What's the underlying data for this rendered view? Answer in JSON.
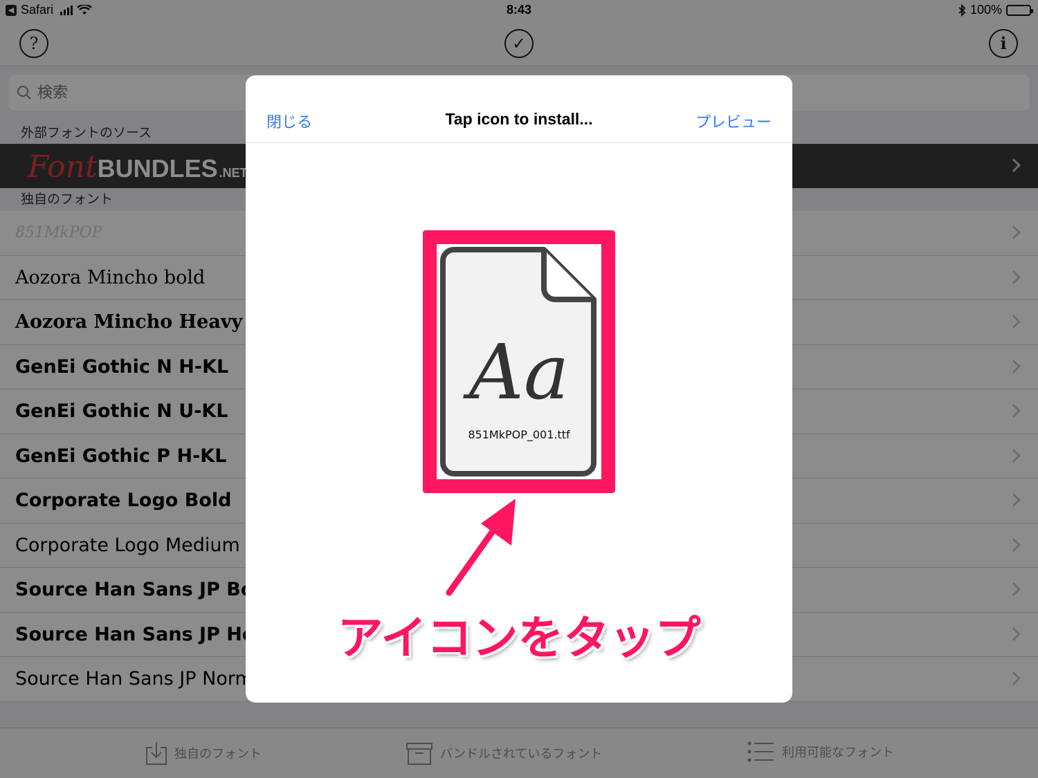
{
  "status_bar": {
    "back_app": "Safari",
    "time": "8:43",
    "battery": "100%"
  },
  "nav_bar": {
    "help_icon": "?",
    "check_icon": "✓",
    "info_icon": "i"
  },
  "search": {
    "placeholder": "検索"
  },
  "sections": {
    "external": "外部フォントのソース",
    "own": "独自のフォント"
  },
  "fontbundles": {
    "part1": "Font",
    "part2": "BUNDLES",
    "part3": ".NET"
  },
  "fonts": [
    {
      "label": "851MkPOP"
    },
    {
      "label": "Aozora Mincho bold"
    },
    {
      "label": "Aozora Mincho Heavy"
    },
    {
      "label": "GenEi Gothic N H-KL"
    },
    {
      "label": "GenEi Gothic N U-KL"
    },
    {
      "label": "GenEi Gothic P H-KL"
    },
    {
      "label": "Corporate Logo Bold"
    },
    {
      "label": "Corporate Logo Medium"
    },
    {
      "label": "Source Han Sans JP Bold"
    },
    {
      "label": "Source Han Sans JP Heav"
    },
    {
      "label": "Source Han Sans JP Norma"
    }
  ],
  "tabs": [
    {
      "label": "独自のフォント"
    },
    {
      "label": "バンドルされているフォント"
    },
    {
      "label": "利用可能なフォント"
    }
  ],
  "modal": {
    "close": "閉じる",
    "title": "Tap icon to install...",
    "preview": "プレビュー",
    "file_glyph": "Aa",
    "file_name": "851MkPOP_001.ttf",
    "annotation": "アイコンをタップ"
  },
  "colors": {
    "accent": "#3478f6",
    "highlight": "#ff1560"
  }
}
